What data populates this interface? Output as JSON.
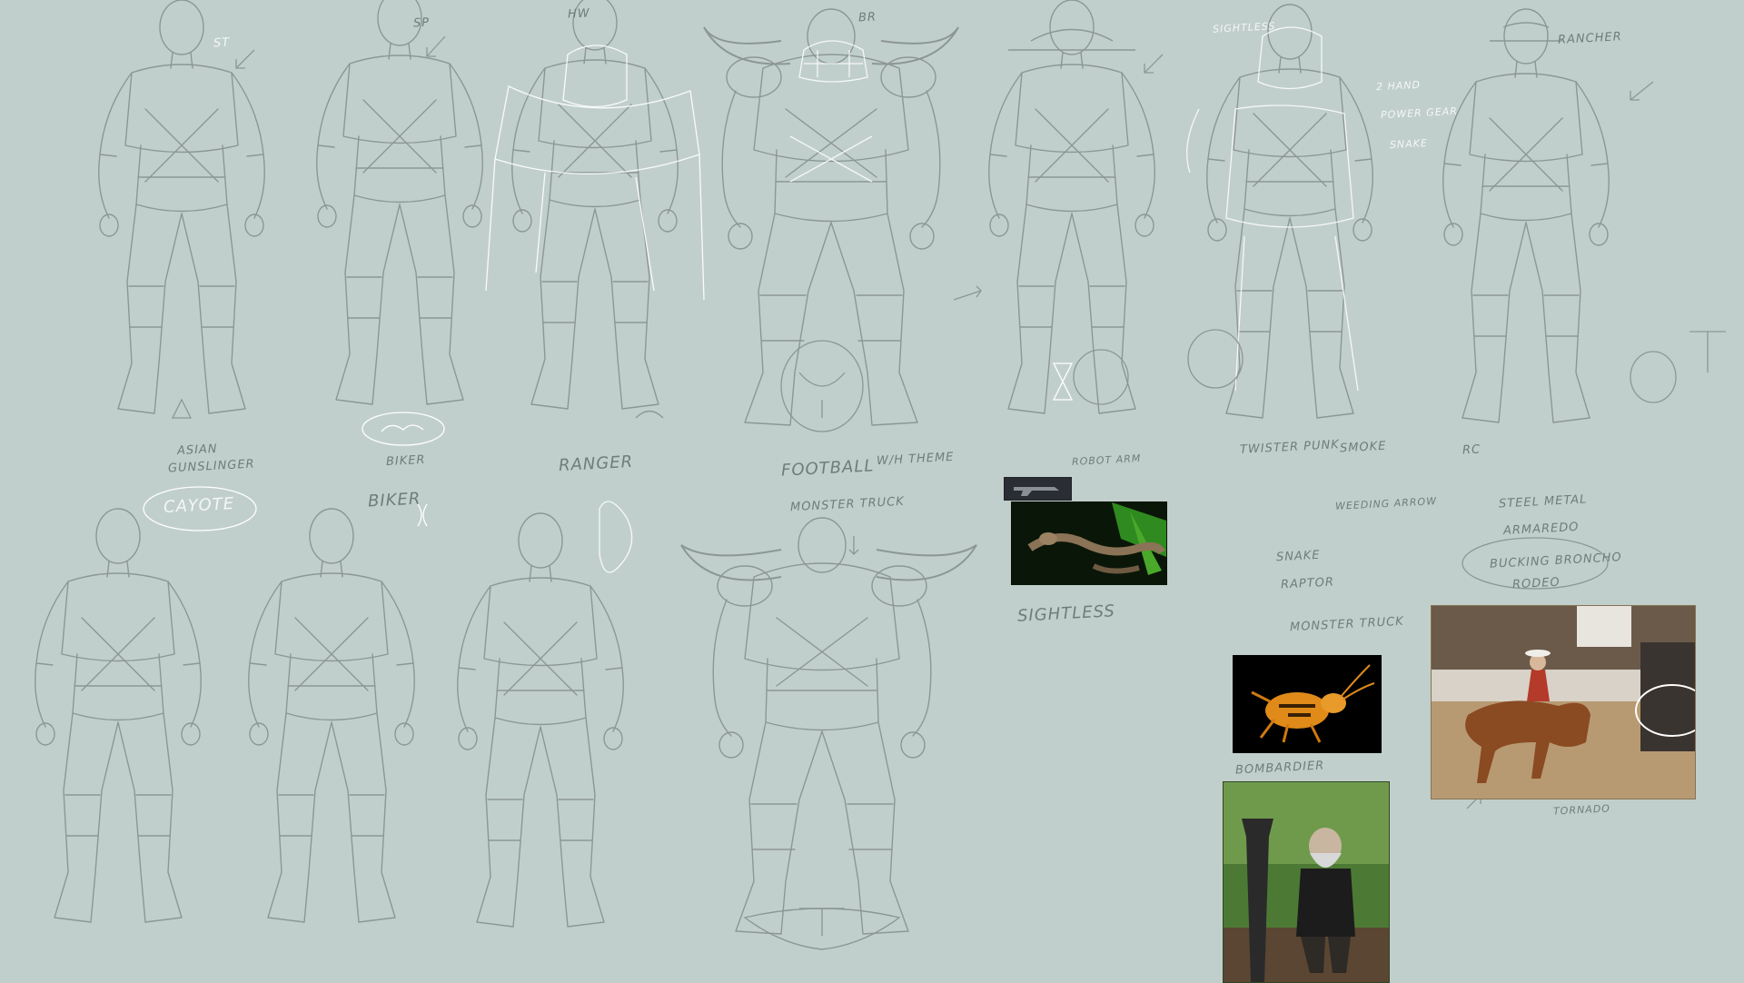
{
  "background_color": "#c1cfcc",
  "line_color": "#8c9795",
  "highlight_color": "#ffffff",
  "sketch_labels": {
    "c1_tag": "ST",
    "c1_a": "ASIAN",
    "c1_b": "GUNSLINGER",
    "c1_c": "CAYOTE",
    "c2_tag": "SP",
    "c2_a": "BIKER",
    "c2_b": "BIKER",
    "c3_tag": "HW",
    "c3_a": "RANGER",
    "c4_tag": "BR",
    "c4_a": "FOOTBALL",
    "c4_b": "W/H THEME",
    "c4_c": "MONSTER TRUCK",
    "c5_a": "ROBOT ARM",
    "c5_b": "SIGHTLESS",
    "c6_a": "SIGHTLESS",
    "c6_b": "2 HAND",
    "c6_c": "POWER GEAR",
    "c6_d": "TWISTER PUNK",
    "c6_e": "SNAKE",
    "c6_f": "SMOKE",
    "c6_g": "WEEDING ARROW",
    "c6_h": "SNAKE",
    "c6_i": "RAPTOR",
    "c6_j": "MONSTER TRUCK",
    "c7_a": "RANCHER",
    "c7_b": "RC",
    "c7_c": "STEEL METAL",
    "c7_d": "ARMAREDO",
    "c7_e": "BUCKING BRONCHO",
    "c7_f": "RODEO",
    "c7_g": "BOMBARDIER",
    "c7_h": "TORNADO"
  },
  "icons": [
    "rodeo-ref-icon",
    "snake-ref-icon",
    "beetle-ref-icon",
    "blacksmith-ref-icon"
  ]
}
